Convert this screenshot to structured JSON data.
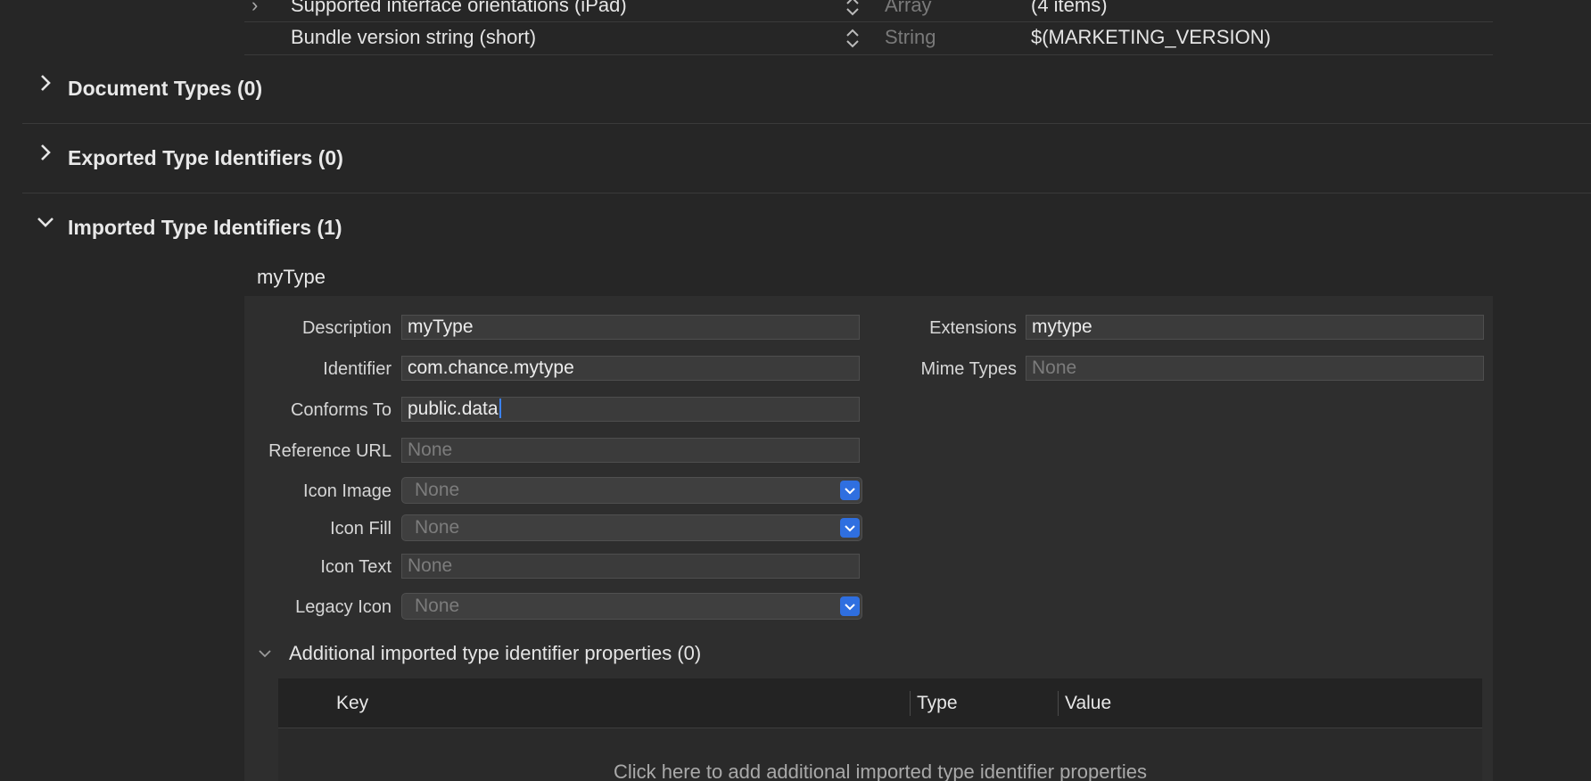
{
  "plist": {
    "rows": [
      {
        "key": "Supported interface orientations (iPad)",
        "type": "Array",
        "value": "(4 items)"
      },
      {
        "key": "Bundle version string (short)",
        "type": "String",
        "value": "$(MARKETING_VERSION)"
      }
    ]
  },
  "sections": {
    "document_types": "Document Types (0)",
    "exported_type_identifiers": "Exported Type Identifiers (0)",
    "imported_type_identifiers": "Imported Type Identifiers (1)"
  },
  "imported_type": {
    "name": "myType",
    "labels": {
      "description": "Description",
      "identifier": "Identifier",
      "conforms_to": "Conforms To",
      "reference_url": "Reference URL",
      "icon_image": "Icon Image",
      "icon_fill": "Icon Fill",
      "icon_text": "Icon Text",
      "legacy_icon": "Legacy Icon",
      "extensions": "Extensions",
      "mime_types": "Mime Types"
    },
    "values": {
      "description": "myType",
      "identifier": "com.chance.mytype",
      "conforms_to": "public.data",
      "extensions": "mytype"
    },
    "placeholders": {
      "reference_url": "None",
      "icon_text": "None",
      "mime_types": "None"
    },
    "popups": {
      "icon_image": "None",
      "icon_fill": "None",
      "legacy_icon": "None"
    }
  },
  "additional": {
    "title": "Additional imported type identifier properties (0)",
    "columns": [
      "Key",
      "Type",
      "Value"
    ],
    "hint": "Click here to add additional imported type identifier properties"
  },
  "colors": {
    "background": "#262626",
    "panel": "#2e2e2e",
    "accent_blue": "#2f6fe0"
  }
}
